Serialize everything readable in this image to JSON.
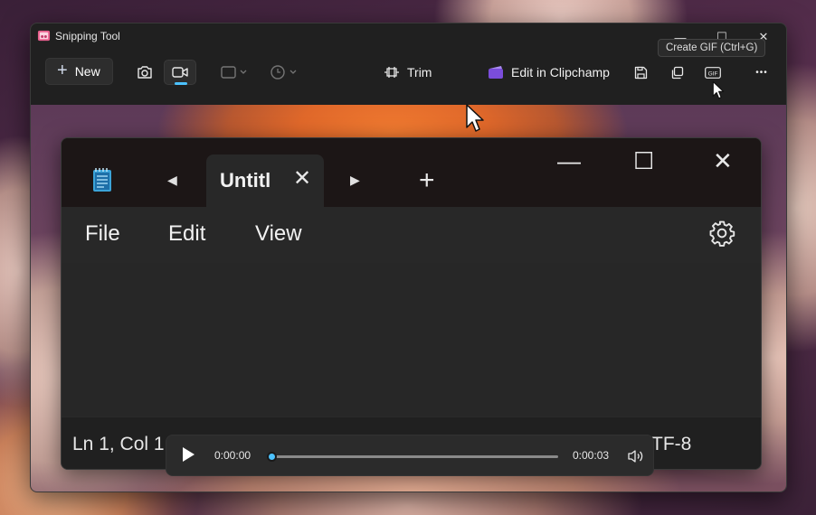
{
  "snip": {
    "title": "Snipping Tool",
    "toolbar": {
      "new_label": "New",
      "trim_label": "Trim",
      "clipchamp_label": "Edit in Clipchamp",
      "tooltip": "Create GIF (Ctrl+G)",
      "gif_label": "GIF",
      "more_label": "•••"
    },
    "window_controls": {
      "minimize": "—",
      "maximize": "☐",
      "close": "✕"
    }
  },
  "notepad": {
    "tab_title": "Untitl",
    "tab_close": "✕",
    "new_tab": "+",
    "menu": [
      "File",
      "Edit",
      "View"
    ],
    "status": {
      "position": "Ln 1, Col 1",
      "encoding": "TF-8"
    },
    "controls": {
      "minimize": "—",
      "maximize": "☐",
      "close": "✕"
    }
  },
  "player": {
    "current_time": "0:00:00",
    "total_time": "0:00:03",
    "progress": 0.0
  },
  "colors": {
    "accent": "#4cc2ff",
    "window_bg": "#202020",
    "clipchamp": "#7b4ddb"
  }
}
